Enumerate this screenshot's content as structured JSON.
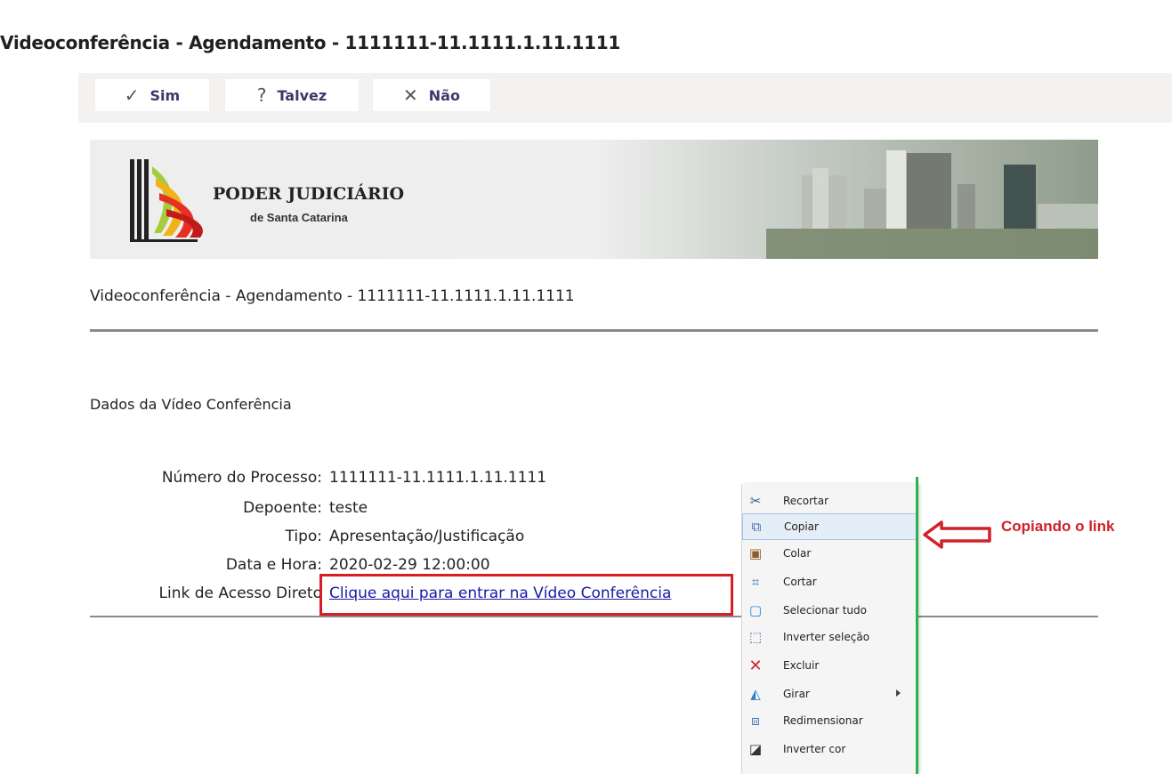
{
  "subject": "Videoconferência - Agendamento - 1111111-11.1111.1.11.1111",
  "rsvp": {
    "yes": {
      "label": "Sim",
      "icon": "check-icon"
    },
    "maybe": {
      "label": "Talvez",
      "icon": "question-icon"
    },
    "no": {
      "label": "Não",
      "icon": "x-icon"
    }
  },
  "banner": {
    "org": "PODER JUDICIÁRIO",
    "org_sub": "de Santa Catarina"
  },
  "message": {
    "title": "Videoconferência - Agendamento - 1111111-11.1111.1.11.1111",
    "section": "Dados da Vídeo Conferência",
    "fields": [
      {
        "label": "Número do Processo:",
        "value": "1111111-11.1111.1.11.1111"
      },
      {
        "label": "Depoente:",
        "value": "teste"
      },
      {
        "label": "Tipo:",
        "value": "Apresentação/Justificação"
      },
      {
        "label": "Data e Hora:",
        "value": "2020-02-29 12:00:00"
      }
    ],
    "link_label": "Link de Acesso Direto",
    "link_text": "Clique aqui para entrar na Vídeo Conferência"
  },
  "context_menu": {
    "items": [
      {
        "label": "Recortar",
        "icon": "scissors-icon"
      },
      {
        "label": "Copiar",
        "icon": "copy-icon"
      },
      {
        "label": "Colar",
        "icon": "paste-icon"
      },
      {
        "label": "Cortar",
        "icon": "crop-icon"
      },
      {
        "label": "Selecionar tudo",
        "icon": "select-all-icon"
      },
      {
        "label": "Inverter seleção",
        "icon": "invert-selection-icon"
      },
      {
        "label": "Excluir",
        "icon": "delete-icon"
      },
      {
        "label": "Girar",
        "icon": "rotate-icon"
      },
      {
        "label": "Redimensionar",
        "icon": "resize-icon"
      },
      {
        "label": "Inverter cor",
        "icon": "invert-color-icon"
      }
    ]
  },
  "annotation": "Copiando o link",
  "colors": {
    "annotation": "#d0202a",
    "highlight_box": "#d51f26",
    "guide_line": "#2bb24c",
    "link": "#1a1aa6"
  }
}
